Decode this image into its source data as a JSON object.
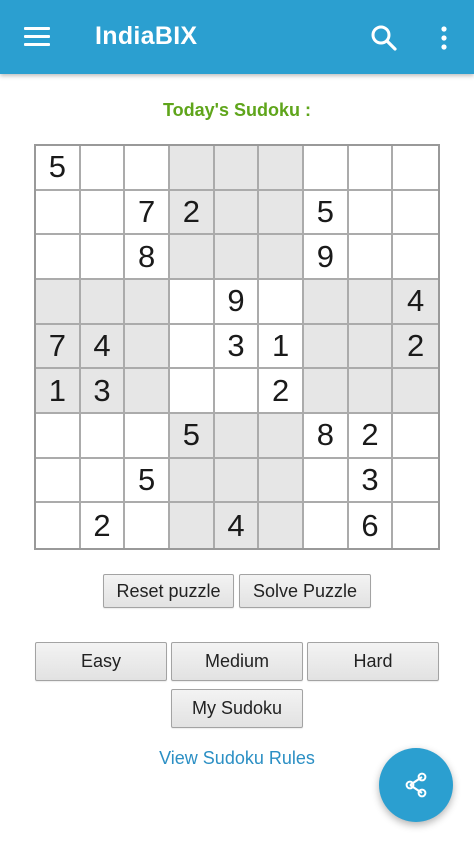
{
  "app_bar": {
    "title": "IndiaBIX",
    "background_color": "#2b9fd0",
    "icons": [
      "menu-icon",
      "search-icon",
      "more-vertical-icon"
    ]
  },
  "heading": {
    "text": "Today's Sudoku :",
    "color": "#5fa51b"
  },
  "sudoku": {
    "grid": [
      [
        "5",
        "",
        "",
        "",
        "",
        "",
        "",
        "",
        ""
      ],
      [
        "",
        "",
        "7",
        "2",
        "",
        "",
        "5",
        "",
        ""
      ],
      [
        "",
        "",
        "8",
        "",
        "",
        "",
        "9",
        "",
        ""
      ],
      [
        "",
        "",
        "",
        "",
        "9",
        "",
        "",
        "",
        "4"
      ],
      [
        "7",
        "4",
        "",
        "",
        "3",
        "1",
        "",
        "",
        "2"
      ],
      [
        "1",
        "3",
        "",
        "",
        "",
        "2",
        "",
        "",
        ""
      ],
      [
        "",
        "",
        "",
        "5",
        "",
        "",
        "8",
        "2",
        ""
      ],
      [
        "",
        "",
        "5",
        "",
        "",
        "",
        "",
        "3",
        ""
      ],
      [
        "",
        "2",
        "",
        "",
        "4",
        "",
        "",
        "6",
        ""
      ]
    ],
    "shaded_box_color": "#e6e6e6"
  },
  "actions": {
    "reset_label": "Reset puzzle",
    "solve_label": "Solve Puzzle"
  },
  "levels": {
    "easy_label": "Easy",
    "medium_label": "Medium",
    "hard_label": "Hard",
    "my_sudoku_label": "My Sudoku"
  },
  "rules_link": {
    "text": "View Sudoku Rules",
    "color": "#2b8fc4"
  },
  "fab": {
    "icon": "share-icon"
  }
}
